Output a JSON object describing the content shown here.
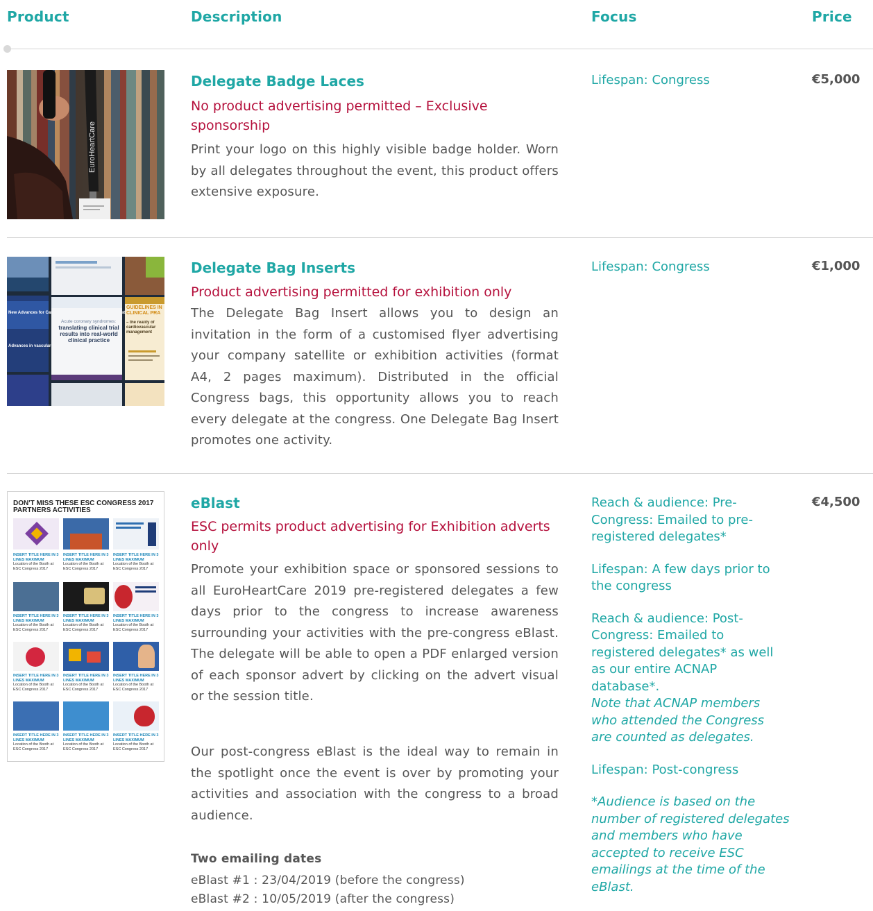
{
  "header": {
    "product": "Product",
    "description": "Description",
    "focus": "Focus",
    "price": "Price"
  },
  "rows": [
    {
      "image": "Delegate wearing EuroHeartCare badge lace",
      "title": "Delegate Badge Laces",
      "subtitle": "No product advertising permitted – Exclusive sponsorship",
      "description": "Print your logo on this highly visible badge holder. Worn by all delegates throughout the event, this product offers extensive exposure.",
      "focus": "Lifespan: Congress",
      "price": "€5,000",
      "lace_text": "EuroHeartCare"
    },
    {
      "image": "Congress flyer inserts collage",
      "title": "Delegate Bag Inserts",
      "subtitle": "Product advertising permitted for exhibition only",
      "description": "The Delegate Bag Insert allows you to design an invitation in the form of a customised flyer advertising your company satellite or exhibition activities (format A4, 2 pages maximum). Distributed in the official Congress bags, this opportunity allows you to reach every delegate at the congress. One Delegate Bag Insert promotes one activity.",
      "focus": "Lifespan: Congress",
      "price": "€1,000",
      "flyer_texts": {
        "f1": "Acute coronary syndromes:",
        "f2": "translating clinical trial results into real-world clinical practice",
        "f3": "GUIDELINES IN CLINICAL PRA",
        "f4": "– the reality of cardiovascular management",
        "f5": "New Advances for Cardioversion Recent Onset rial Fibrillation",
        "f6": "Advances in vascular reduction Risk Patients"
      }
    },
    {
      "image": "eBlast newsletter mockup",
      "title": "eBlast",
      "subtitle": "ESC permits product advertising for Exhibition adverts only",
      "description_p1": "Promote your exhibition space or sponsored sessions to all EuroHeartCare 2019 pre-registered delegates a few days prior to the congress to increase awareness surrounding your activities with the pre-congress eBlast. The delegate will be able to open a PDF enlarged version of each sponsor advert by clicking on the advert visual or the session title.",
      "description_p2": "Our post-congress eBlast is the ideal way to remain in the spotlight once the event is over by promoting your activities and association with the congress to a broad audience.",
      "dates_heading": "Two emailing dates",
      "date_1": "eBlast #1 : 23/04/2019 (before the congress)",
      "date_2": "eBlast #2 : 10/05/2019 (after the congress)",
      "focus_1": "Reach & audience: Pre-Congress: Emailed to pre-registered delegates*",
      "focus_2": "Lifespan: A few days prior to the congress",
      "focus_3": "Reach & audience: Post-Congress: Emailed to registered delegates* as well as our entire ACNAP database*.",
      "focus_3_note": "Note that ACNAP members who attended the Congress are counted as delegates.",
      "focus_4": "Lifespan: Post-congress",
      "focus_5": "*Audience is based on the number of registered delegates and members who have accepted to receive ESC emailings at the time of the eBlast.",
      "price": "€4,500",
      "thumb": {
        "headline": "DON'T MISS THESE ESC CONGRESS 2017 PARTNERS ACTIVITIES",
        "cell_title": "INSERT TITLE HERE IN 3 LINES MAXIMUM",
        "cell_loc": "Location of the Booth at ESC Congress 2017"
      }
    }
  ],
  "colors": {
    "teal": "#1fa7a5",
    "crimson": "#b5103c",
    "body_text": "#555555"
  }
}
